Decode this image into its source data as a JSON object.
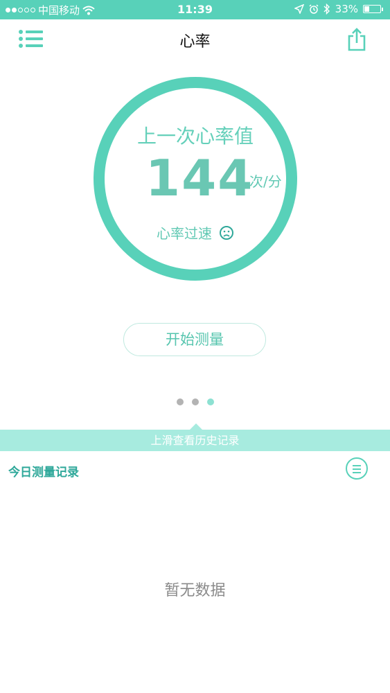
{
  "status_bar": {
    "carrier": "●●○○○ 中国移动",
    "time": "11:39",
    "battery_text": "33%",
    "battery_level": 0.33,
    "signal_strength": 2
  },
  "header": {
    "title": "心率"
  },
  "heart_rate": {
    "label": "上一次心率值",
    "value": "144",
    "unit": "次/分",
    "status": "心率过速",
    "status_icon": "sad-face-icon"
  },
  "actions": {
    "measure_label": "开始测量"
  },
  "pager": {
    "count": 3,
    "active_index": 2
  },
  "history": {
    "swipe_hint": "上滑查看历史记录",
    "today_label": "今日测量记录",
    "empty_text": "暂无数据"
  },
  "colors": {
    "accent": "#58d1b9",
    "accent_light": "#a7ebdf",
    "text_accent": "#56c5ae"
  }
}
